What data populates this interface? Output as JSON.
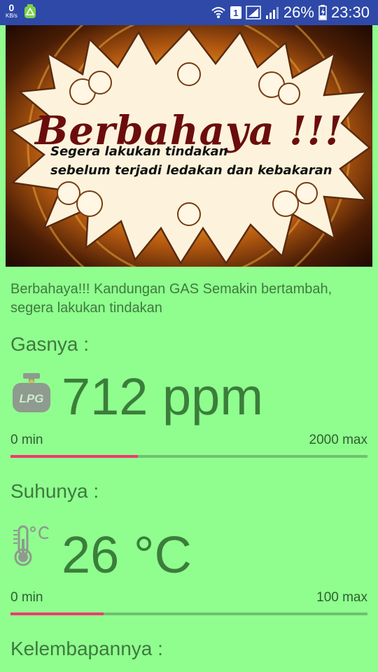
{
  "status_bar": {
    "net_speed": "0",
    "net_unit": "KB/s",
    "sim_slot": "1",
    "battery": "26%",
    "time": "23:30"
  },
  "banner": {
    "title": "Berbahaya !!!",
    "line1": "Segera lakukan tindakan",
    "line2": "sebelum terjadi ledakan dan kebakaran"
  },
  "message": "Berbahaya!!! Kandungan GAS Semakin bertambah, segera lakukan tindakan",
  "gas": {
    "label": "Gasnya :",
    "value": "712 ppm",
    "min_label": "0 min",
    "max_label": "2000 max",
    "level": 0.356,
    "icon": "lpg-cylinder-icon"
  },
  "temperature": {
    "label": "Suhunya :",
    "value": "26 °C",
    "min_label": "0 min",
    "max_label": "100 max",
    "level": 0.26,
    "icon": "thermometer-celsius-icon"
  },
  "humidity": {
    "label": "Kelembapannya :"
  },
  "colors": {
    "background": "#90fe8f",
    "status_bar": "#2e49a8",
    "progress_fill": "#ee3a6f",
    "progress_track": "#6fc26e",
    "text": "#3d7a3d"
  }
}
